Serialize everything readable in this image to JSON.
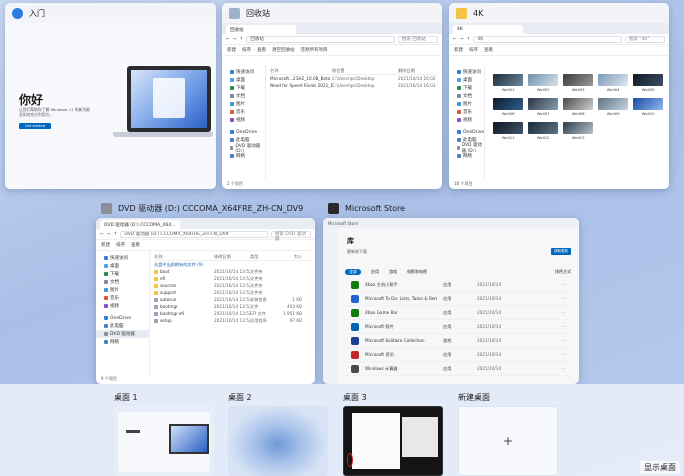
{
  "windows": {
    "intro": {
      "title": "入门",
      "greeting": "你好",
      "body": "让我们帮助你了解 Windows 11 的新功能及如何充分利用它。",
      "button": "Get started"
    },
    "recycle": {
      "title": "回收站",
      "tab": "回收站",
      "address": "回收站",
      "search": "搜索 回收站",
      "toolbar": [
        "新建",
        "排序",
        "查看",
        "清空回收站",
        "还原所有项目"
      ],
      "sidebar": [
        "快速访问",
        "桌面",
        "下载",
        "文档",
        "图片",
        "音乐",
        "视频",
        "此电脑",
        "OneDrive",
        "此电脑",
        "DVD 驱动器 (D:)",
        "网络"
      ],
      "columns": [
        "名称",
        "原位置",
        "删除日期"
      ],
      "files": [
        {
          "name": "Microsoft...21H2_10.0B_Beta",
          "location": "C:\\Users\\pc\\Desktop",
          "date": "2021/10/14 16:02"
        },
        {
          "name": "Need for Speed Rivals 2021_10...",
          "location": "C:\\Users\\pc\\Desktop",
          "date": "2021/10/14 16:03"
        }
      ],
      "status": "2 个项目"
    },
    "folder4k": {
      "title": "4K",
      "tab": "4K",
      "address": "4K",
      "search": "搜索 \"4K\"",
      "toolbar": [
        "新建",
        "排序",
        "查看"
      ],
      "sidebar": [
        "快速访问",
        "桌面",
        "下载",
        "文档",
        "图片",
        "音乐",
        "视频",
        "此电脑",
        "OneDrive",
        "此电脑",
        "DVD 驱动器 (D:)",
        "网络"
      ],
      "thumbs": [
        "Wall01",
        "Wall02",
        "Wall03",
        "Wall04",
        "Wall05",
        "Wall06",
        "Wall07",
        "Wall08",
        "Wall09",
        "Wall10",
        "Wall11",
        "Wall12",
        "Wall13"
      ],
      "status": "18 个项目"
    },
    "dvd": {
      "title": "DVD 驱动器 (D:) CCCOMA_X64FRE_ZH-CN_DV9",
      "tab": "DVD 驱动器 (D:) CCCOMA_X64...",
      "address": "DVD 驱动器 (D:) CCCOMA_X64FRE_ZH-CN_DV9",
      "search": "搜索 DVD 驱动器",
      "toolbar": [
        "新建",
        "排序",
        "查看"
      ],
      "sidebar": [
        "快速访问",
        "桌面",
        "下载",
        "文档",
        "图片",
        "音乐",
        "视频",
        "此电脑",
        "OneDrive",
        "此电脑",
        "DVD 驱动器",
        "网络"
      ],
      "group": "光盘中当前拥有的文件 (9)",
      "columns": [
        "名称",
        "修改日期",
        "类型",
        "大小"
      ],
      "files": [
        {
          "name": "boot",
          "date": "2021/10/14 13:52",
          "type": "文件夹",
          "size": ""
        },
        {
          "name": "efi",
          "date": "2021/10/14 13:52",
          "type": "文件夹",
          "size": ""
        },
        {
          "name": "sources",
          "date": "2021/10/14 13:52",
          "type": "文件夹",
          "size": ""
        },
        {
          "name": "support",
          "date": "2021/10/14 13:52",
          "type": "文件夹",
          "size": ""
        },
        {
          "name": "autorun",
          "date": "2021/10/14 13:52",
          "type": "安装信息",
          "size": "1 KB"
        },
        {
          "name": "bootmgr",
          "date": "2021/10/14 13:52",
          "type": "文件",
          "size": "403 KB"
        },
        {
          "name": "bootmgr.efi",
          "date": "2021/10/14 13:52",
          "type": "EFI 文件",
          "size": "1,951 KB"
        },
        {
          "name": "setup",
          "date": "2021/10/14 13:52",
          "type": "应用程序",
          "size": "97 KB"
        }
      ],
      "status": "9 个项目"
    },
    "store": {
      "title": "Microsoft Store",
      "header": "库",
      "update_label": "获取更新",
      "subtitle": "更新和下载",
      "filters": [
        "全部",
        "应用",
        "游戏",
        "电影和电视",
        "排序方式"
      ],
      "apps": [
        {
          "name": "Xbox 主机小帮手",
          "type": "应用",
          "date": "2021/10/14"
        },
        {
          "name": "Microsoft To Do: Lists, Tasks & Reminders",
          "type": "应用",
          "date": "2021/10/14"
        },
        {
          "name": "Xbox Game Bar",
          "type": "应用",
          "date": "2021/10/14"
        },
        {
          "name": "Microsoft 照片",
          "type": "应用",
          "date": "2021/10/14"
        },
        {
          "name": "Microsoft Solitaire Collection",
          "type": "游戏",
          "date": "2021/10/14"
        },
        {
          "name": "Microsoft 资讯",
          "type": "应用",
          "date": "2021/10/14"
        },
        {
          "name": "Windows 计算器",
          "type": "应用",
          "date": "2021/10/14"
        }
      ]
    }
  },
  "desktops": [
    {
      "label": "桌面 1"
    },
    {
      "label": "桌面 2"
    },
    {
      "label": "桌面 3"
    },
    {
      "label": "新建桌面",
      "plus": "+"
    }
  ],
  "show_desktop": "显示桌面",
  "colors": {
    "accent": "#0067c0",
    "folder": "#f4c542",
    "dock": "#e8eef8"
  }
}
